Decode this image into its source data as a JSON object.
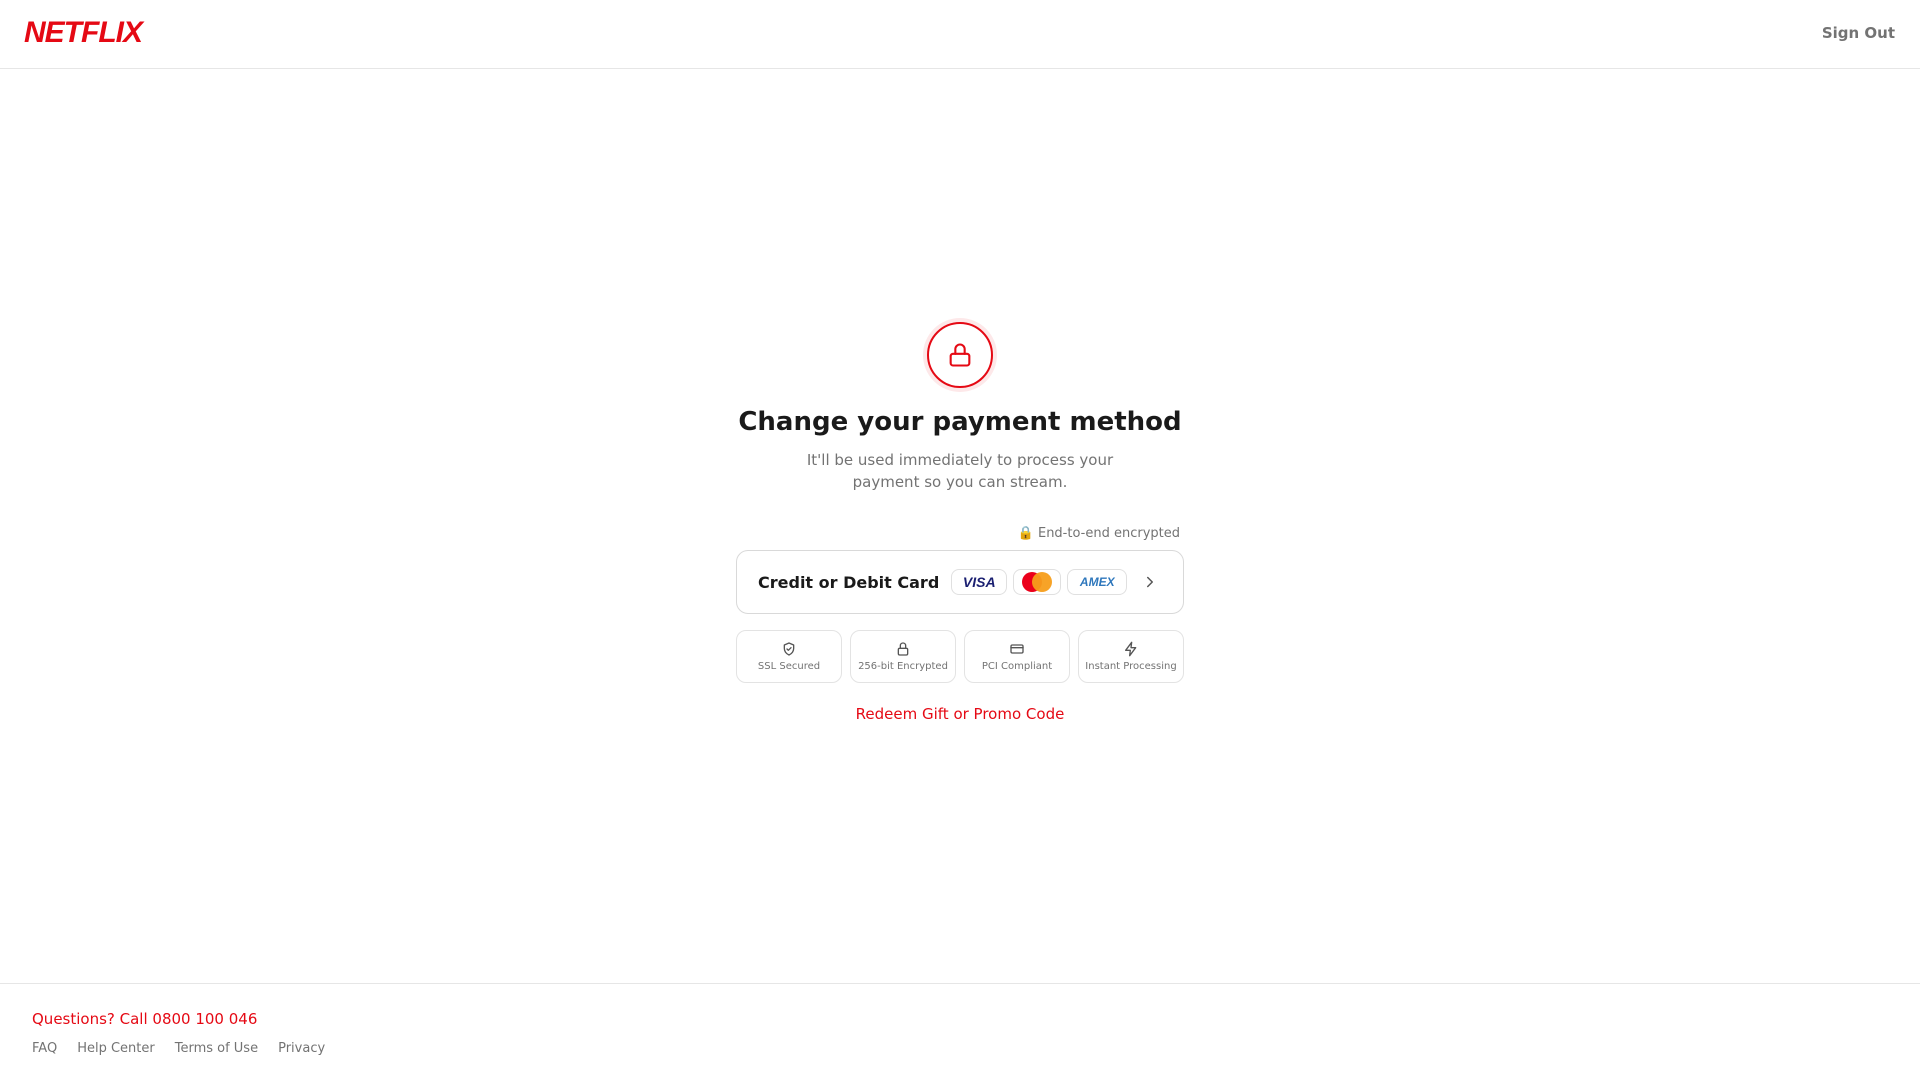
{
  "header": {
    "logo": "NETFLIX",
    "sign_out": "Sign Out"
  },
  "main": {
    "icon": "lock-icon",
    "title": "Change your payment method",
    "subtitle_line1": "It'll be used immediately to process your",
    "subtitle_line2": "payment so you can stream.",
    "encrypted_note": "🔒 End-to-end encrypted",
    "payment_option": {
      "label": "Credit or Debit Card",
      "brands": [
        "VISA",
        "mastercard",
        "AMEX"
      ]
    },
    "badges": [
      {
        "icon": "shield-check-icon",
        "label": "SSL Secured"
      },
      {
        "icon": "lock-icon",
        "label": "256-bit Encrypted"
      },
      {
        "icon": "credit-card-icon",
        "label": "PCI Compliant"
      },
      {
        "icon": "lightning-icon",
        "label": "Instant Processing"
      }
    ],
    "redeem_link": "Redeem Gift or Promo Code"
  },
  "footer": {
    "questions": "Questions? Call 0800 100 046",
    "links": [
      "FAQ",
      "Help Center",
      "Terms of Use",
      "Privacy"
    ]
  },
  "colors": {
    "brand_red": "#e50914",
    "muted_text": "#737373",
    "border": "#d9d9d9"
  }
}
